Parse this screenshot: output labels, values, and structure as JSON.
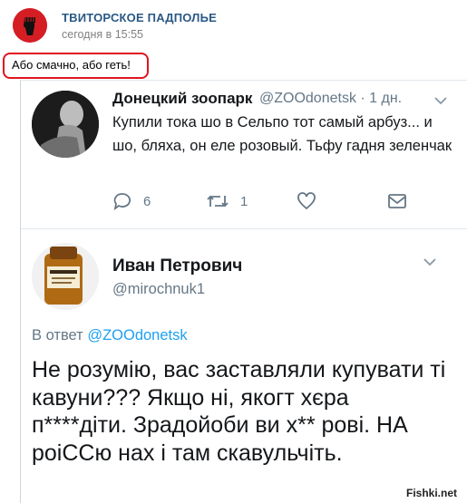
{
  "vk_post": {
    "group_name": "ТВИТОРСКОЕ ПАДПОЛЬЕ",
    "timestamp": "сегодня в 15:55",
    "text": "Або смачно, або геть!",
    "highlight_color": "#e0141e"
  },
  "tweet1": {
    "display_name": "Донецкий зоопарк",
    "handle_and_time": "@ZOOdonetsk · 1 дн.",
    "text": "Купили тока шо в Сельпо тот самый арбуз... и шо, бляха, он еле розовый. Тьфу гадня зеленчак",
    "actions": [
      {
        "icon": "reply-icon",
        "count": "6"
      },
      {
        "icon": "retweet-icon",
        "count": "1"
      },
      {
        "icon": "like-icon",
        "count": ""
      },
      {
        "icon": "message-icon",
        "count": ""
      }
    ]
  },
  "tweet2": {
    "display_name": "Иван Петрович",
    "handle": "@mirochnuk1",
    "reply_prefix": "В ответ",
    "reply_handle": "@ZOOdonetsk",
    "text": "Не розумію, вас заставляли купувати ті кавуни??? Якщо ні, якогт хєра п****діти. Зрадойоби ви х** рові. НА роіССю нах і там скавульчіть."
  },
  "watermark": "Fishki.net"
}
